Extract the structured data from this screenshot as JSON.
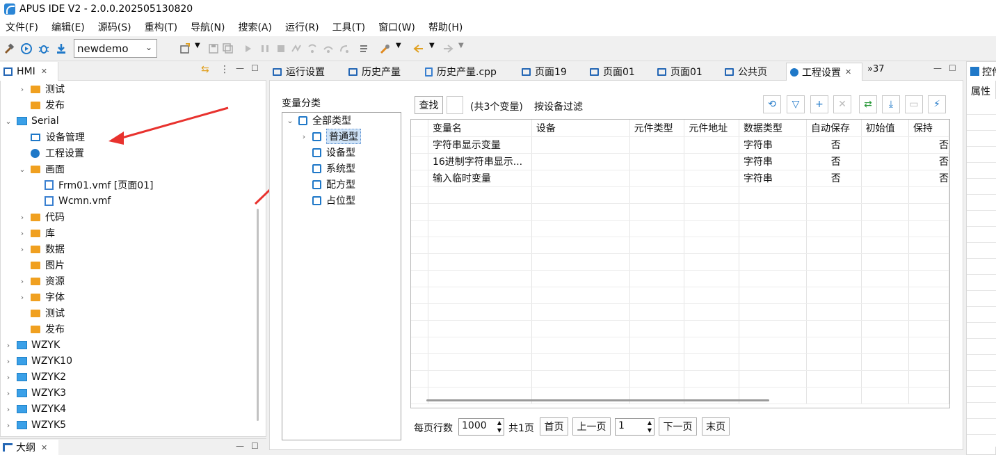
{
  "window": {
    "title": "APUS IDE V2 - 2.0.0.202505130820"
  },
  "menu": [
    "文件(F)",
    "编辑(E)",
    "源码(S)",
    "重构(T)",
    "导航(N)",
    "搜索(A)",
    "运行(R)",
    "工具(T)",
    "窗口(W)",
    "帮助(H)"
  ],
  "toolbar": {
    "project_combo": "newdemo"
  },
  "left_panel": {
    "tab": "HMI",
    "tree": [
      {
        "label": "测试",
        "indent": 1,
        "chev": "›",
        "icon": "folder"
      },
      {
        "label": "发布",
        "indent": 1,
        "chev": "",
        "icon": "folder"
      },
      {
        "label": "Serial",
        "indent": 0,
        "chev": "⌄",
        "icon": "proj"
      },
      {
        "label": "设备管理",
        "indent": 1,
        "chev": "",
        "icon": "mon"
      },
      {
        "label": "工程设置",
        "indent": 1,
        "chev": "",
        "icon": "gear"
      },
      {
        "label": "画面",
        "indent": 1,
        "chev": "⌄",
        "icon": "folder"
      },
      {
        "label": "Frm01.vmf [页面01]",
        "indent": 2,
        "chev": "",
        "icon": "file"
      },
      {
        "label": "Wcmn.vmf",
        "indent": 2,
        "chev": "",
        "icon": "file"
      },
      {
        "label": "代码",
        "indent": 1,
        "chev": "›",
        "icon": "folder"
      },
      {
        "label": "库",
        "indent": 1,
        "chev": "›",
        "icon": "folder"
      },
      {
        "label": "数据",
        "indent": 1,
        "chev": "›",
        "icon": "folder"
      },
      {
        "label": "图片",
        "indent": 1,
        "chev": "",
        "icon": "folder"
      },
      {
        "label": "资源",
        "indent": 1,
        "chev": "›",
        "icon": "folder"
      },
      {
        "label": "字体",
        "indent": 1,
        "chev": "›",
        "icon": "folder"
      },
      {
        "label": "测试",
        "indent": 1,
        "chev": "",
        "icon": "folder"
      },
      {
        "label": "发布",
        "indent": 1,
        "chev": "",
        "icon": "folder"
      },
      {
        "label": "WZYK",
        "indent": 0,
        "chev": "›",
        "icon": "proj"
      },
      {
        "label": "WZYK10",
        "indent": 0,
        "chev": "›",
        "icon": "proj"
      },
      {
        "label": "WZYK2",
        "indent": 0,
        "chev": "›",
        "icon": "proj"
      },
      {
        "label": "WZYK3",
        "indent": 0,
        "chev": "›",
        "icon": "proj"
      },
      {
        "label": "WZYK4",
        "indent": 0,
        "chev": "›",
        "icon": "proj"
      },
      {
        "label": "WZYK5",
        "indent": 0,
        "chev": "›",
        "icon": "proj"
      }
    ],
    "bottom_tab": "大纲"
  },
  "editor_tabs": [
    "运行设置",
    "历史产量",
    "历史产量.cpp",
    "页面19",
    "页面01",
    "页面01",
    "公共页",
    "工程设置"
  ],
  "overflow_tabs": "»37",
  "right_panel": {
    "tab": "控件",
    "label": "属性"
  },
  "var_panel": {
    "category_title": "变量分类",
    "categories": [
      {
        "label": "全部类型",
        "level": 0,
        "chev": "⌄"
      },
      {
        "label": "普通型",
        "level": 1,
        "chev": "›",
        "selected": true
      },
      {
        "label": "设备型",
        "level": 1,
        "chev": ""
      },
      {
        "label": "系统型",
        "level": 1,
        "chev": ""
      },
      {
        "label": "配方型",
        "level": 1,
        "chev": ""
      },
      {
        "label": "占位型",
        "level": 1,
        "chev": ""
      }
    ],
    "find_button": "查找",
    "count_text": "(共3个变量)",
    "filter_text": "按设备过滤",
    "columns": [
      "变量名",
      "设备",
      "元件类型",
      "元件地址",
      "数据类型",
      "自动保存",
      "初始值",
      "保持"
    ],
    "rows": [
      [
        "字符串显示变量",
        "",
        "",
        "",
        "字符串",
        "否",
        "",
        "否"
      ],
      [
        "16进制字符串显示...",
        "",
        "",
        "",
        "字符串",
        "否",
        "",
        "否"
      ],
      [
        "输入临时变量",
        "",
        "",
        "",
        "字符串",
        "否",
        "",
        "否"
      ]
    ],
    "pager": {
      "rows_per_page_label": "每页行数",
      "rows_per_page": "1000",
      "total_pages": "共1页",
      "first": "首页",
      "prev": "上一页",
      "page": "1",
      "next": "下一页",
      "last": "末页"
    }
  },
  "colors": {
    "accent": "#1f78c8",
    "arrow": "#e8322e",
    "selection": "#cfe3f7"
  }
}
